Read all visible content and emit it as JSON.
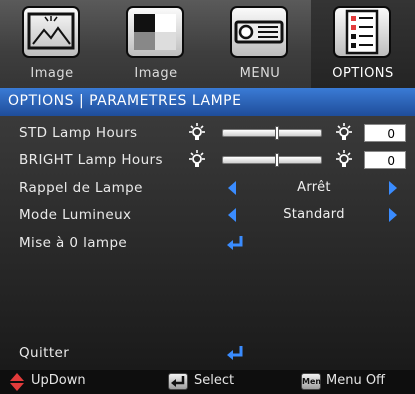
{
  "tabs": [
    {
      "label": "Image",
      "icon": "picture-frame-icon",
      "active": false
    },
    {
      "label": "Image",
      "icon": "contrast-icon",
      "active": false
    },
    {
      "label": "MENU",
      "icon": "projector-icon",
      "active": false
    },
    {
      "label": "OPTIONS",
      "icon": "checklist-icon",
      "active": true
    }
  ],
  "header": {
    "title": "OPTIONS | PARAMETRES LAMPE"
  },
  "rows": {
    "std_lamp": {
      "label": "STD Lamp Hours",
      "value": "0",
      "level": 0.55
    },
    "bright_lamp": {
      "label": "BRIGHT Lamp Hours",
      "value": "0",
      "level": 0.55
    },
    "rappel": {
      "label": "Rappel de Lampe",
      "value": "Arrêt"
    },
    "mode": {
      "label": "Mode Lumineux",
      "value": "Standard"
    },
    "reset": {
      "label": "Mise à 0 lampe"
    },
    "quit": {
      "label": "Quitter"
    }
  },
  "footer": {
    "updown": "UpDown",
    "select": "Select",
    "menu_key": "Menu",
    "menu_off": "Menu Off"
  },
  "colors": {
    "accent": "#3a8cff",
    "header": "#2e63b8",
    "arrow_red": "#e23b3b"
  }
}
